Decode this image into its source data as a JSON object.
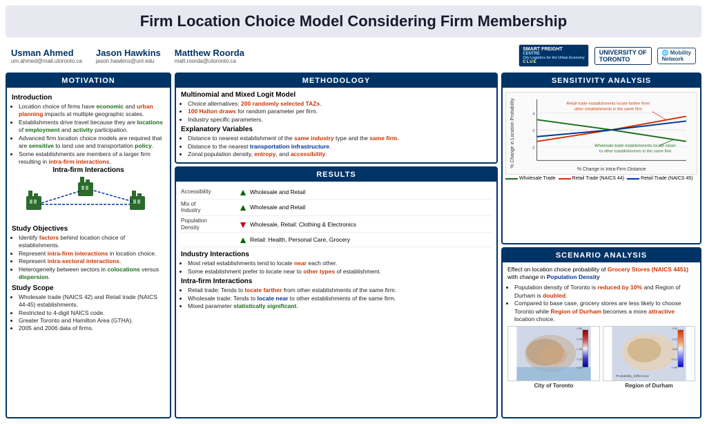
{
  "title": "Firm Location Choice Model Considering Firm Membership",
  "authors": [
    {
      "name": "Usman Ahmed",
      "email": "um.ahmed@mail.utoronto.ca"
    },
    {
      "name": "Jason Hawkins",
      "email": "jason.hawkins@unl.edu"
    },
    {
      "name": "Matthew Roorda",
      "email": "matt.roorda@utoronto.ca"
    }
  ],
  "logos": [
    "Smart Freight Centre",
    "University of Toronto",
    "Mobility Network"
  ],
  "panels": {
    "motivation": {
      "header": "MOTIVATION",
      "sections": {
        "introduction": {
          "title": "Introduction",
          "bullets": [
            "Location choice of firms have economic and urban planning impacts at multiple geographic scales.",
            "Establishments drive travel because they are locations of employment and activity participation.",
            "Advanced firm location choice models are required that are sensitive to land use and transportation policy.",
            "Some establishments are members of a larger firm resulting in intra-firm interactions."
          ]
        },
        "intra_firm_title": "Intra-firm Interactions",
        "study_objectives": {
          "title": "Study Objectives",
          "bullets": [
            "Identify factors behind location choice of establishments.",
            "Represent intra-firm interactions in location choice.",
            "Represent intra-sectoral interactions.",
            "Heterogeneity between sectors in colocations versus dispersion."
          ]
        },
        "study_scope": {
          "title": "Study Scope",
          "bullets": [
            "Wholesale trade (NAICS 42) and Retail trade (NAICS 44-45) establishments.",
            "Restricted to 4-digit NAICS code.",
            "Greater Toronto and Hamilton Area (GTHA).",
            "2005 and 2006 data of firms."
          ]
        }
      }
    },
    "methodology": {
      "header": "METHODOLOGY",
      "model_title": "Multinomial and Mixed Logit Model",
      "model_bullets": [
        "Choice alternatives: 200 randomly selected TAZs.",
        "100 Halton draws for random parameter per firm.",
        "Industry specific parameters."
      ],
      "explanatory_title": "Explanatory Variables",
      "explanatory_bullets": [
        "Distance to nearest establishment of the same industry type and the same firm.",
        "Distance to the nearest transportation infrastructure.",
        "Zonal population density, entropy, and accessibility."
      ]
    },
    "results": {
      "header": "RESULTS",
      "table": [
        {
          "label": "Accessibility",
          "arrow": "up",
          "value": "Wholesale and Retail"
        },
        {
          "label": "Mix of\nIndustry",
          "arrow": "up",
          "value": "Wholesale and Retail"
        },
        {
          "label": "Population\nDensity",
          "arrow": "down",
          "value": "Wholesale, Retail: Clothing & Electronics"
        },
        {
          "label": "",
          "arrow": "up",
          "value": "Retail: Health, Personal Care, Grocery"
        }
      ],
      "industry_interactions_title": "Industry Interactions",
      "industry_bullets": [
        "Most retail establishments tend to locate near each other.",
        "Some establishment prefer to locate near to other types of establishment."
      ],
      "intra_firm_title": "Intra-firm Interactions",
      "intra_firm_bullets": [
        "Retail trade: Tends to locate farther from other establishments of the same firm.",
        "Wholesale trade: Tends to locate near to other establishments of the same firm.",
        "Mixed parameter statistically significant."
      ]
    },
    "sensitivity": {
      "header": "SENSITIVITY ANALYSIS",
      "chart_labels": {
        "y_axis": "% Change in Location Probability",
        "x_axis": "% Change in Intra-Firm Distance"
      },
      "annotations": [
        "Retail trade establishments locate farther from other establishments in the same firm",
        "Wholesale trade establishments locate closer to other establishments in the same firm"
      ],
      "legend": [
        {
          "label": "Wholesale Trade",
          "color": "#1a6b1a"
        },
        {
          "label": "Retail Trade (NAICS 44)",
          "color": "#cc3300"
        },
        {
          "label": "Retail Trade (NAICS 45)",
          "color": "#003399"
        }
      ]
    },
    "scenario": {
      "header": "SCENARIO ANALYSIS",
      "subtitle": "Effect on location choice probability of Grocery Stores (NAICS 4451) with change in Population Density",
      "bullets": [
        "Population density of Toronto is reduced by 10% and Region of Durham is doubled.",
        "Compared to base case, grocery stores are less likely to choose Toronto while Region of Durham becomes a more attractive location choice."
      ],
      "map_labels": [
        "City of Toronto",
        "Region of Durham"
      ]
    }
  }
}
